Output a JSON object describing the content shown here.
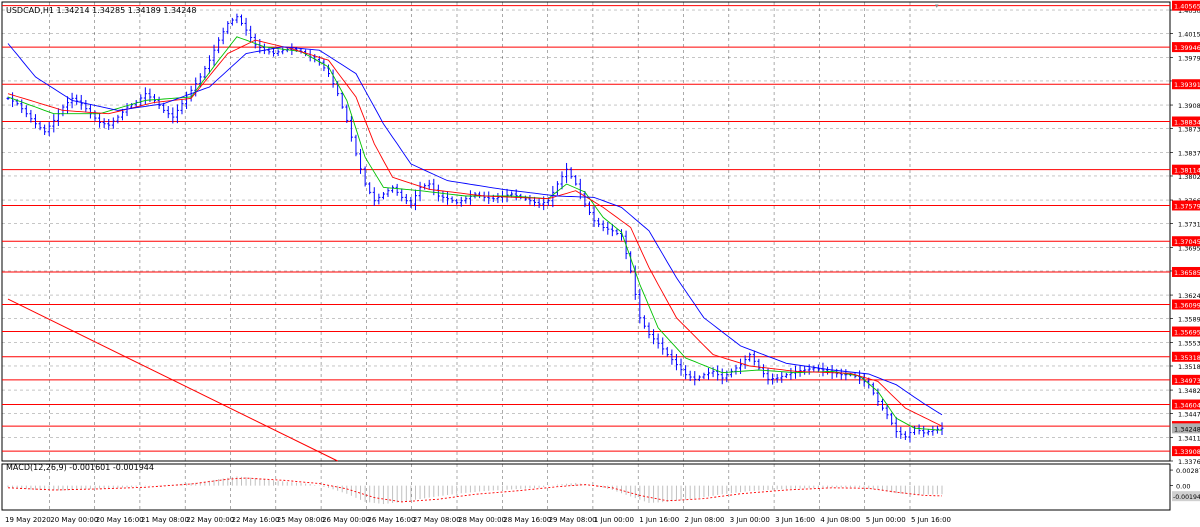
{
  "chart_data": [
    {
      "type": "candlestick",
      "symbol_line": "USDCAD,H1  1.34214 1.34285 1.34189 1.34248",
      "price_ticks": [
        "1.40500",
        "1.40150",
        "1.39790",
        "1.39440",
        "1.39080",
        "1.38730",
        "1.38370",
        "1.38020",
        "1.37660",
        "1.37310",
        "1.36950",
        "1.36600",
        "1.36240",
        "1.35890",
        "1.35530",
        "1.35180",
        "1.34820",
        "1.34470",
        "1.34110",
        "1.33760"
      ],
      "time_ticks": [
        "19 May 2020",
        "20 May 00:00",
        "20 May 16:00",
        "21 May 08:00",
        "22 May 00:00",
        "22 May 16:00",
        "25 May 08:00",
        "26 May 00:00",
        "26 May 16:00",
        "27 May 08:00",
        "28 May 00:00",
        "28 May 16:00",
        "29 May 08:00",
        "1 Jun 00:00",
        "1 Jun 16:00",
        "2 Jun 08:00",
        "3 Jun 00:00",
        "3 Jun 16:00",
        "4 Jun 08:00",
        "5 Jun 00:00",
        "5 Jun 16:00"
      ],
      "ylim": [
        1.3376,
        1.4062
      ],
      "grid": true,
      "horizontal_levels": [
        "1.40565",
        "1.39946",
        "1.39391",
        "1.38834",
        "1.38114",
        "1.37579",
        "1.37045",
        "1.36585",
        "1.36099",
        "1.35695",
        "1.35318",
        "1.34973",
        "1.34604",
        "1.34282",
        "1.33908"
      ],
      "current_price_label": "1.34248",
      "level_color": "#ff0000",
      "price_color": "#0000ff",
      "ma_colors": [
        "#00c000",
        "#ff0000",
        "#0000ff"
      ],
      "trendline": {
        "from": [
          0,
          1.3618
        ],
        "to": [
          72,
          1.3376
        ]
      },
      "price_path": [
        [
          0,
          1.3918
        ],
        [
          2,
          1.391
        ],
        [
          4,
          1.3895
        ],
        [
          6,
          1.388
        ],
        [
          8,
          1.3868
        ],
        [
          10,
          1.3885
        ],
        [
          12,
          1.3905
        ],
        [
          14,
          1.3918
        ],
        [
          16,
          1.391
        ],
        [
          18,
          1.3895
        ],
        [
          20,
          1.3882
        ],
        [
          22,
          1.3878
        ],
        [
          24,
          1.389
        ],
        [
          26,
          1.3905
        ],
        [
          28,
          1.3912
        ],
        [
          30,
          1.3925
        ],
        [
          32,
          1.3915
        ],
        [
          34,
          1.39
        ],
        [
          36,
          1.389
        ],
        [
          38,
          1.391
        ],
        [
          40,
          1.393
        ],
        [
          42,
          1.395
        ],
        [
          44,
          1.3975
        ],
        [
          46,
          1.4005
        ],
        [
          48,
          1.403
        ],
        [
          50,
          1.404
        ],
        [
          52,
          1.402
        ],
        [
          54,
          1.3998
        ],
        [
          56,
          1.399
        ],
        [
          58,
          1.3985
        ],
        [
          60,
          1.399
        ],
        [
          62,
          1.3992
        ],
        [
          64,
          1.3988
        ],
        [
          66,
          1.398
        ],
        [
          68,
          1.3972
        ],
        [
          70,
          1.3955
        ],
        [
          72,
          1.3925
        ],
        [
          74,
          1.3885
        ],
        [
          76,
          1.3835
        ],
        [
          78,
          1.379
        ],
        [
          80,
          1.3765
        ],
        [
          82,
          1.3775
        ],
        [
          84,
          1.3785
        ],
        [
          86,
          1.377
        ],
        [
          88,
          1.376
        ],
        [
          90,
          1.3785
        ],
        [
          92,
          1.379
        ],
        [
          94,
          1.3772
        ],
        [
          96,
          1.3768
        ],
        [
          98,
          1.3762
        ],
        [
          100,
          1.3768
        ],
        [
          102,
          1.3775
        ],
        [
          104,
          1.377
        ],
        [
          106,
          1.3768
        ],
        [
          108,
          1.3772
        ],
        [
          110,
          1.3775
        ],
        [
          112,
          1.377
        ],
        [
          114,
          1.3765
        ],
        [
          116,
          1.376
        ],
        [
          118,
          1.3765
        ],
        [
          120,
          1.379
        ],
        [
          122,
          1.3812
        ],
        [
          124,
          1.379
        ],
        [
          126,
          1.376
        ],
        [
          128,
          1.3735
        ],
        [
          130,
          1.3725
        ],
        [
          132,
          1.372
        ],
        [
          134,
          1.3712
        ],
        [
          136,
          1.366
        ],
        [
          138,
          1.359
        ],
        [
          140,
          1.3565
        ],
        [
          142,
          1.3552
        ],
        [
          144,
          1.3535
        ],
        [
          146,
          1.352
        ],
        [
          148,
          1.3505
        ],
        [
          150,
          1.3498
        ],
        [
          152,
          1.3505
        ],
        [
          154,
          1.351
        ],
        [
          156,
          1.35
        ],
        [
          158,
          1.351
        ],
        [
          160,
          1.352
        ],
        [
          162,
          1.3535
        ],
        [
          164,
          1.3515
        ],
        [
          166,
          1.3498
        ],
        [
          168,
          1.35
        ],
        [
          170,
          1.3505
        ],
        [
          172,
          1.351
        ],
        [
          174,
          1.3512
        ],
        [
          176,
          1.3515
        ],
        [
          178,
          1.3512
        ],
        [
          180,
          1.3508
        ],
        [
          182,
          1.3505
        ],
        [
          184,
          1.3505
        ],
        [
          186,
          1.35
        ],
        [
          188,
          1.349
        ],
        [
          190,
          1.3465
        ],
        [
          192,
          1.3445
        ],
        [
          194,
          1.342
        ],
        [
          196,
          1.3412
        ],
        [
          198,
          1.3425
        ],
        [
          200,
          1.3418
        ],
        [
          202,
          1.3422
        ],
        [
          204,
          1.3425
        ]
      ],
      "ma_fast": [
        [
          0,
          1.392
        ],
        [
          10,
          1.3895
        ],
        [
          20,
          1.3895
        ],
        [
          30,
          1.3915
        ],
        [
          40,
          1.392
        ],
        [
          46,
          1.3975
        ],
        [
          50,
          1.401
        ],
        [
          56,
          1.3995
        ],
        [
          64,
          1.3988
        ],
        [
          70,
          1.3965
        ],
        [
          74,
          1.3915
        ],
        [
          78,
          1.383
        ],
        [
          82,
          1.3785
        ],
        [
          90,
          1.378
        ],
        [
          100,
          1.3772
        ],
        [
          110,
          1.3772
        ],
        [
          118,
          1.3768
        ],
        [
          122,
          1.379
        ],
        [
          126,
          1.3778
        ],
        [
          130,
          1.374
        ],
        [
          134,
          1.3718
        ],
        [
          138,
          1.364
        ],
        [
          142,
          1.3575
        ],
        [
          148,
          1.353
        ],
        [
          156,
          1.3508
        ],
        [
          164,
          1.3512
        ],
        [
          172,
          1.3508
        ],
        [
          180,
          1.351
        ],
        [
          186,
          1.3503
        ],
        [
          190,
          1.348
        ],
        [
          194,
          1.344
        ],
        [
          198,
          1.3425
        ],
        [
          204,
          1.3422
        ]
      ],
      "ma_mid": [
        [
          0,
          1.3925
        ],
        [
          12,
          1.39
        ],
        [
          22,
          1.3895
        ],
        [
          32,
          1.3912
        ],
        [
          40,
          1.3918
        ],
        [
          48,
          1.3985
        ],
        [
          54,
          1.4005
        ],
        [
          62,
          1.3992
        ],
        [
          70,
          1.3975
        ],
        [
          76,
          1.392
        ],
        [
          80,
          1.385
        ],
        [
          84,
          1.38
        ],
        [
          92,
          1.3782
        ],
        [
          104,
          1.3772
        ],
        [
          118,
          1.3768
        ],
        [
          124,
          1.378
        ],
        [
          130,
          1.3755
        ],
        [
          136,
          1.3725
        ],
        [
          140,
          1.3665
        ],
        [
          146,
          1.359
        ],
        [
          154,
          1.3535
        ],
        [
          162,
          1.3518
        ],
        [
          172,
          1.351
        ],
        [
          184,
          1.3507
        ],
        [
          190,
          1.3495
        ],
        [
          196,
          1.3455
        ],
        [
          204,
          1.3428
        ]
      ],
      "ma_slow": [
        [
          0,
          1.4
        ],
        [
          6,
          1.395
        ],
        [
          14,
          1.3915
        ],
        [
          24,
          1.39
        ],
        [
          34,
          1.391
        ],
        [
          44,
          1.3935
        ],
        [
          52,
          1.3985
        ],
        [
          60,
          1.3995
        ],
        [
          68,
          1.399
        ],
        [
          76,
          1.3955
        ],
        [
          82,
          1.388
        ],
        [
          88,
          1.382
        ],
        [
          96,
          1.3795
        ],
        [
          108,
          1.3782
        ],
        [
          120,
          1.3772
        ],
        [
          128,
          1.377
        ],
        [
          134,
          1.3755
        ],
        [
          140,
          1.372
        ],
        [
          146,
          1.365
        ],
        [
          152,
          1.359
        ],
        [
          160,
          1.3548
        ],
        [
          170,
          1.3522
        ],
        [
          180,
          1.3512
        ],
        [
          188,
          1.3506
        ],
        [
          194,
          1.349
        ],
        [
          200,
          1.3462
        ],
        [
          204,
          1.3445
        ]
      ]
    },
    {
      "type": "histogram",
      "label": "MACD(12,26,9) -0.001601 -0.001944",
      "value_ticks": [
        "0.002878",
        "0.00",
        "-0.001944"
      ],
      "ylim": [
        -0.0045,
        0.004
      ],
      "signal_color": "#ff0000",
      "histogram": [
        [
          0,
          -0.0003
        ],
        [
          6,
          -0.0008
        ],
        [
          12,
          -0.0009
        ],
        [
          18,
          -0.0006
        ],
        [
          24,
          -0.0004
        ],
        [
          30,
          -0.0001
        ],
        [
          36,
          0.0002
        ],
        [
          42,
          0.0006
        ],
        [
          46,
          0.0012
        ],
        [
          50,
          0.0017
        ],
        [
          54,
          0.0014
        ],
        [
          60,
          0.0008
        ],
        [
          66,
          0.0003
        ],
        [
          70,
          -0.0004
        ],
        [
          74,
          -0.0015
        ],
        [
          78,
          -0.003
        ],
        [
          82,
          -0.0034
        ],
        [
          86,
          -0.003
        ],
        [
          92,
          -0.0022
        ],
        [
          98,
          -0.0015
        ],
        [
          104,
          -0.001
        ],
        [
          110,
          -0.0007
        ],
        [
          116,
          -0.0004
        ],
        [
          120,
          0.0002
        ],
        [
          124,
          0.0005
        ],
        [
          128,
          0.0
        ],
        [
          132,
          -0.0008
        ],
        [
          136,
          -0.002
        ],
        [
          140,
          -0.0032
        ],
        [
          144,
          -0.003
        ],
        [
          150,
          -0.0024
        ],
        [
          156,
          -0.0016
        ],
        [
          162,
          -0.001
        ],
        [
          168,
          -0.0007
        ],
        [
          174,
          -0.0005
        ],
        [
          180,
          -0.0003
        ],
        [
          186,
          -0.0003
        ],
        [
          190,
          -0.0008
        ],
        [
          194,
          -0.0014
        ],
        [
          198,
          -0.0017
        ],
        [
          204,
          -0.0016
        ]
      ],
      "signal": [
        [
          0,
          -0.0004
        ],
        [
          10,
          -0.0008
        ],
        [
          20,
          -0.0006
        ],
        [
          30,
          -0.0003
        ],
        [
          40,
          0.0003
        ],
        [
          48,
          0.0012
        ],
        [
          52,
          0.0014
        ],
        [
          60,
          0.001
        ],
        [
          68,
          0.0004
        ],
        [
          74,
          -0.0006
        ],
        [
          80,
          -0.0022
        ],
        [
          86,
          -0.003
        ],
        [
          94,
          -0.0025
        ],
        [
          102,
          -0.0016
        ],
        [
          112,
          -0.0009
        ],
        [
          120,
          -0.0002
        ],
        [
          126,
          0.0002
        ],
        [
          132,
          -0.0004
        ],
        [
          138,
          -0.0018
        ],
        [
          144,
          -0.0028
        ],
        [
          152,
          -0.0024
        ],
        [
          160,
          -0.0015
        ],
        [
          170,
          -0.0008
        ],
        [
          180,
          -0.0004
        ],
        [
          188,
          -0.0005
        ],
        [
          194,
          -0.0012
        ],
        [
          200,
          -0.0018
        ],
        [
          204,
          -0.0019
        ]
      ]
    }
  ]
}
